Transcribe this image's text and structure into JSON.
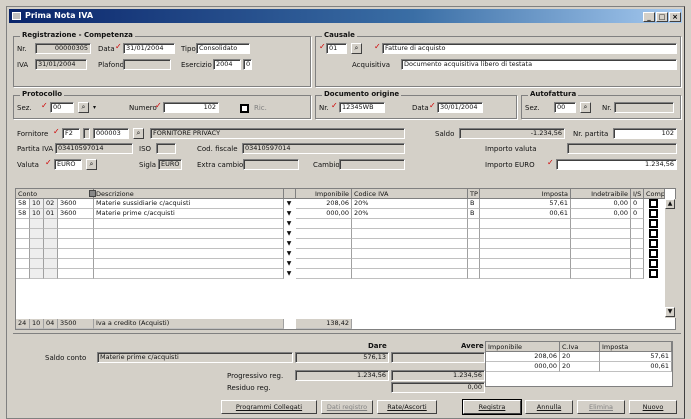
{
  "window": {
    "title": "Prima Nota IVA",
    "controls": [
      "_",
      "□",
      "×"
    ]
  },
  "registrazione": {
    "group_title": "Registrazione - Competenza",
    "nr_label": "Nr.",
    "nr_value": "00000305",
    "data_label": "Data",
    "data_value": "31/01/2004",
    "tipo_label": "Tipo",
    "tipo_value": "Consolidato",
    "iva_label": "IVA",
    "iva_value": "31/01/2004",
    "plafond_label": "Plafond",
    "plafond_value": "",
    "esercizio_label": "Esercizio",
    "esercizio_value": "2004",
    "esercizio_suffix": "0"
  },
  "causale": {
    "group_title": "Causale",
    "code": "01",
    "description": "Fatture di acquisto",
    "acquisitiva_label": "Acquisitiva",
    "acquisitiva_value": "Documento acquisitiva libero di testata"
  },
  "protocollo": {
    "group_title": "Protocollo",
    "sez_label": "Sez.",
    "sez_value": "00",
    "numero_label": "Numero",
    "numero_value": "102",
    "ric_label": "Ric."
  },
  "documento": {
    "group_title": "Documento origine",
    "nr_label": "Nr.",
    "nr_value": "12345WB",
    "data_label": "Data",
    "data_value": "30/01/2004"
  },
  "autofattura": {
    "group_title": "Autofattura",
    "sez_label": "Sez.",
    "sez_value": "00",
    "nr_label": "Nr."
  },
  "fornitore": {
    "label": "Fornitore",
    "code1": "F2",
    "code2": "000003",
    "name": "FORNITORE PRIVACY",
    "partita_iva_label": "Partita IVA",
    "partita_iva_value": "03410597014",
    "iso_label": "ISO",
    "iso_value": "",
    "cod_fiscale_label": "Cod. fiscale",
    "cod_fiscale_value": "03410597014",
    "valuta_label": "Valuta",
    "valuta_value": "EURO",
    "sigla_label": "Sigla",
    "sigla_value": "EURO",
    "extra_cambio_label": "Extra cambio",
    "cambio_label": "Cambio"
  },
  "totali_testata": {
    "saldo_label": "Saldo",
    "saldo_value": "-1.234,56",
    "nr_partita_label": "Nr. partita",
    "nr_partita_value": "102",
    "importo_valuta_label": "Importo valuta",
    "importo_euro_label": "Importo EURO",
    "importo_euro_value": "1.234,56"
  },
  "grid": {
    "headers": [
      "Conto",
      "Descrizione",
      "Imponibile",
      "Codice IVA",
      "TP",
      "Imposta",
      "Indetraibile",
      "I/S",
      "Comp."
    ],
    "rows": [
      {
        "c1": "58",
        "c2": "10",
        "c3": "02",
        "c4": "3600",
        "desc": "Materie sussidiarie c/acquisti",
        "imponibile": "208,06",
        "codice_iva": "20%",
        "tp": "B",
        "imposta": "57,61",
        "indetraibile": "0,00",
        "is": "0",
        "comp": true
      },
      {
        "c1": "58",
        "c2": "10",
        "c3": "01",
        "c4": "3600",
        "desc": "Materie prime c/acquisti",
        "imponibile": "000,00",
        "codice_iva": "20%",
        "tp": "B",
        "imposta": "00,61",
        "indetraibile": "0,00",
        "is": "0",
        "comp": true
      },
      {
        "c1": "",
        "c2": "",
        "c3": "",
        "c4": "",
        "desc": "",
        "imponibile": "",
        "codice_iva": "",
        "tp": "",
        "imposta": "",
        "indetraibile": "",
        "is": "",
        "comp": true
      },
      {
        "c1": "",
        "c2": "",
        "c3": "",
        "c4": "",
        "desc": "",
        "imponibile": "",
        "codice_iva": "",
        "tp": "",
        "imposta": "",
        "indetraibile": "",
        "is": "",
        "comp": true
      },
      {
        "c1": "",
        "c2": "",
        "c3": "",
        "c4": "",
        "desc": "",
        "imponibile": "",
        "codice_iva": "",
        "tp": "",
        "imposta": "",
        "indetraibile": "",
        "is": "",
        "comp": true
      },
      {
        "c1": "",
        "c2": "",
        "c3": "",
        "c4": "",
        "desc": "",
        "imponibile": "",
        "codice_iva": "",
        "tp": "",
        "imposta": "",
        "indetraibile": "",
        "is": "",
        "comp": true
      },
      {
        "c1": "",
        "c2": "",
        "c3": "",
        "c4": "",
        "desc": "",
        "imponibile": "",
        "codice_iva": "",
        "tp": "",
        "imposta": "",
        "indetraibile": "",
        "is": "",
        "comp": true
      },
      {
        "c1": "",
        "c2": "",
        "c3": "",
        "c4": "",
        "desc": "",
        "imponibile": "",
        "codice_iva": "",
        "tp": "",
        "imposta": "",
        "indetraibile": "",
        "is": "",
        "comp": true
      }
    ],
    "total_row": {
      "c1": "24",
      "c2": "10",
      "c3": "04",
      "c4": "3500",
      "desc": "Iva a credito (Acquisti)",
      "value": "138,42"
    }
  },
  "footer": {
    "saldo_conto_label": "Saldo conto",
    "saldo_conto_value": "Materie prime c/acquisti",
    "dare_label": "Dare",
    "avere_label": "Avere",
    "saldo_dare": "576,13",
    "saldo_avere": "",
    "progressivo_label": "Progressivo reg.",
    "progressivo_dare": "1.234,56",
    "progressivo_avere": "1.234,56",
    "residuo_label": "Residuo reg.",
    "residuo_avere": "0,00",
    "iva_headers": [
      "Imponibile",
      "C.Iva",
      "Imposta"
    ],
    "iva_rows": [
      {
        "imponibile": "208,06",
        "civa": "20",
        "imposta": "57,61"
      },
      {
        "imponibile": "000,00",
        "civa": "20",
        "imposta": "00,61"
      }
    ]
  },
  "buttons": {
    "collegati": "Programmi Collegati",
    "dati_reg": "Dati registro",
    "rate": "Rate/Ascorti",
    "registra": "Registra",
    "annulla": "Annulla",
    "elimina": "Elimina",
    "nuovo": "Nuovo"
  }
}
